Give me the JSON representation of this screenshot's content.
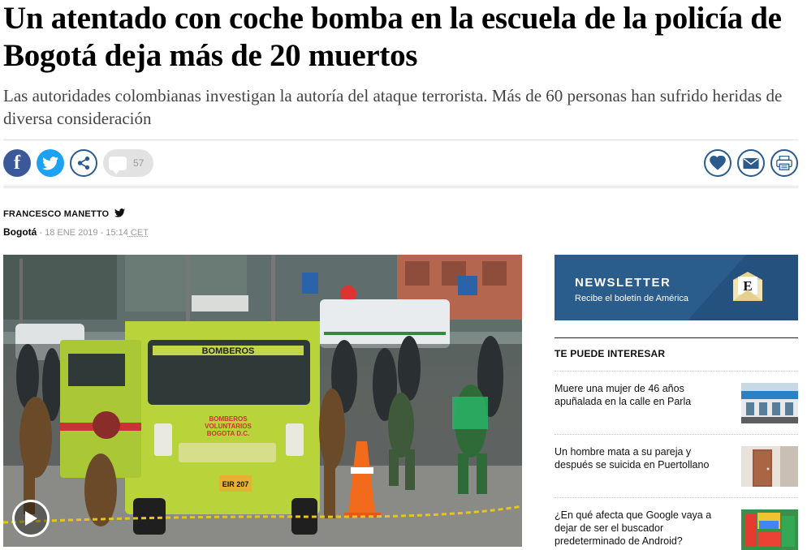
{
  "article": {
    "headline": "Un atentado con coche bomba en la escuela de la policía de Bogotá deja más de 20 muertos",
    "subtitle": "Las autoridades colombianas investigan la autoría del ataque terrorista. Más de 60 personas han sufrido heridas de diversa consideración",
    "author": "FRANCESCO MANETTO",
    "city": "Bogotá",
    "date_sep": " - ",
    "date": "18 ENE 2019 - 15:14",
    "tz": " CET",
    "photo": {
      "truck_top_label": "BOMBEROS",
      "truck_body_line1": "BOMBEROS",
      "truck_body_line2": "VOLUNTARIOS",
      "truck_body_line3": "BOGOTA D.C.",
      "plate": "EIR 207"
    }
  },
  "share": {
    "facebook_icon": "facebook-icon",
    "twitter_icon": "twitter-icon",
    "share_icon": "share-icon",
    "comment_count": "57",
    "right_icons": [
      "heart-icon",
      "mail-icon",
      "print-icon"
    ]
  },
  "newsletter": {
    "title": "NEWSLETTER",
    "subtitle": "Recibe el boletín de América",
    "logo_letter": "E"
  },
  "related": {
    "heading": "TE PUEDE INTERESAR",
    "items": [
      {
        "title": "Muere una mujer de 46 años apuñalada en la calle en Parla"
      },
      {
        "title": "Un hombre mata a su pareja y después se suicida en Puertollano"
      },
      {
        "title": "¿En qué afecta que Google vaya a dejar de ser el buscador predeterminado de Android?"
      }
    ]
  },
  "colors": {
    "brand_blue": "#2a5c8c",
    "facebook": "#3b5998",
    "twitter": "#1da1f2",
    "truck_lime": "#b8d43a"
  }
}
